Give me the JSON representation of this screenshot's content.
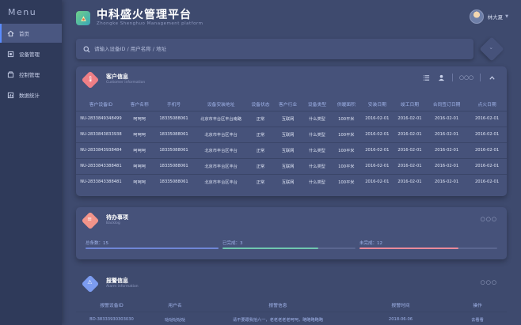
{
  "menu": {
    "title": "Menu",
    "items": [
      {
        "label": "首页",
        "icon": "home-icon"
      },
      {
        "label": "设备管理",
        "icon": "device-icon"
      },
      {
        "label": "控制管理",
        "icon": "control-icon"
      },
      {
        "label": "数据统计",
        "icon": "chart-icon"
      }
    ]
  },
  "header": {
    "title": "中科盛火管理平台",
    "subtitle": "Zhongke Shenghuo Management platform"
  },
  "user": {
    "name": "林大夏"
  },
  "search": {
    "placeholder": "请输入设备ID / 用户名称 / 地址"
  },
  "customer": {
    "title": "客户信息",
    "subtitle": "Customer information",
    "dots": "○○○",
    "columns": [
      "客户设备ID",
      "客户名称",
      "手机号",
      "设备安装地址",
      "设备状态",
      "客户行业",
      "设备类型",
      "供暖面积",
      "安装日期",
      "竣工日期",
      "合同签订日期",
      "点火日期"
    ],
    "rows": [
      [
        "NU-2833849348499",
        "呵呵呵",
        "18335088061",
        "北京市丰台区丰台南路",
        "正常",
        "互联网",
        "什么类型",
        "100平米",
        "2016-02-01",
        "2016-02-01",
        "2016-02-01",
        "2016-02-01"
      ],
      [
        "NU-2833843833938",
        "呵呵呵",
        "18335088061",
        "北京市丰台区丰台",
        "正常",
        "互联网",
        "什么类型",
        "100平米",
        "2016-02-01",
        "2016-02-01",
        "2016-02-01",
        "2016-02-01"
      ],
      [
        "NU-2833843938484",
        "呵呵呵",
        "18335088061",
        "北京市丰台区丰台",
        "正常",
        "互联网",
        "什么类型",
        "100平米",
        "2016-02-01",
        "2016-02-01",
        "2016-02-01",
        "2016-02-01"
      ],
      [
        "NU-2833843388481",
        "呵呵呵",
        "18335088061",
        "北京市丰台区丰台",
        "正常",
        "互联网",
        "什么类型",
        "100平米",
        "2016-02-01",
        "2016-02-01",
        "2016-02-01",
        "2016-02-01"
      ],
      [
        "NU-2833843388481",
        "呵呵呵",
        "18335088061",
        "北京市丰台区丰台",
        "正常",
        "互联网",
        "什么类型",
        "100平米",
        "2016-02-01",
        "2016-02-01",
        "2016-02-01",
        "2016-02-01"
      ]
    ]
  },
  "backlog": {
    "title": "待办事项",
    "subtitle": "Backlog",
    "dots": "○○○",
    "total": {
      "label": "总条数：15",
      "value": 1.0,
      "color": "#6f86d6"
    },
    "done": {
      "label": "已完成：3",
      "value": 0.72,
      "color": "#6fc6b0"
    },
    "todo": {
      "label": "未完成：12",
      "value": 0.72,
      "color": "#e98a9a"
    }
  },
  "alarm": {
    "title": "报警信息",
    "subtitle": "Alarm information",
    "dots": "○○○",
    "columns": [
      "报警设备ID",
      "用户名",
      "报警信息",
      "报警时间",
      "操作"
    ],
    "rows": [
      [
        "BD-38333930303030",
        "哒哒哒哒哒",
        "请不要跟我拾六一，老老老老老呵呵，略略略略略",
        "2018-06-06",
        "去看看"
      ]
    ]
  },
  "colors": {
    "accent": "#5a8cff",
    "customer_icon": "#ef7f86",
    "backlog_icon": "#f2948a",
    "alarm_icon": "#7c9cf0"
  }
}
